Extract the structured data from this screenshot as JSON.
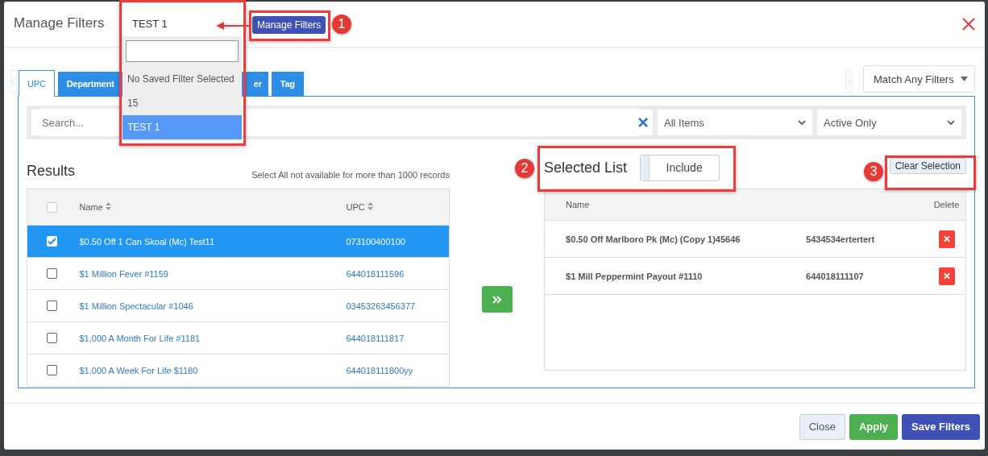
{
  "dialog": {
    "title": "Manage Filters"
  },
  "saved_filter": {
    "value": "TEST 1",
    "expanded": true,
    "options": [
      {
        "label": "No Saved Filter Selected",
        "selected": false
      },
      {
        "label": "15",
        "selected": false
      },
      {
        "label": "TEST 1",
        "selected": true
      }
    ]
  },
  "manage_filters_button": "Manage Filters",
  "tabs": [
    {
      "label": "UPC",
      "selected": true
    },
    {
      "label": "Department",
      "selected": false
    },
    {
      "label": "er",
      "selected": false
    },
    {
      "label": "Tag",
      "selected": false
    }
  ],
  "match_select": {
    "value": "Match Any Filters"
  },
  "search": {
    "placeholder": "Search..."
  },
  "filters": [
    {
      "value": "All Items"
    },
    {
      "value": "Active Only"
    }
  ],
  "results": {
    "title": "Results",
    "note": "Select All not available for more than 1000 records",
    "columns": [
      "Name",
      "UPC"
    ],
    "all_checked": false,
    "rows": [
      {
        "name": "$0.50 Off 1 Can Skoal (Mc) Test11",
        "upc": "073100400100",
        "checked": true
      },
      {
        "name": "$1 Million Fever #1159",
        "upc": "644018111596",
        "checked": false
      },
      {
        "name": "$1 Million Spectacular #1046",
        "upc": "03453263456377",
        "checked": false
      },
      {
        "name": "$1,000 A Month For Life #1181",
        "upc": "644018111817",
        "checked": false
      },
      {
        "name": "$1,000 A Week For Life $1180",
        "upc": "644018111800yy",
        "checked": false
      }
    ]
  },
  "selected_list": {
    "title": "Selected List",
    "toggle": {
      "label": "Include",
      "on": false
    },
    "clear_button": "Clear Selection",
    "columns": [
      "Name",
      "Delete"
    ],
    "rows": [
      {
        "name": "$0.50 Off Marlboro Pk (Mc) (Copy 1)45646",
        "code": "5434534ertertert"
      },
      {
        "name": "$1 Mill Peppermint Payout #1110",
        "code": "644018111107"
      }
    ]
  },
  "footer_buttons": [
    {
      "label": "Close",
      "kind": "default"
    },
    {
      "label": "Apply",
      "kind": "success"
    },
    {
      "label": "Save Filters",
      "kind": "primary"
    }
  ],
  "annotations": [
    {
      "number": "1"
    },
    {
      "number": "2"
    },
    {
      "number": "3"
    }
  ]
}
